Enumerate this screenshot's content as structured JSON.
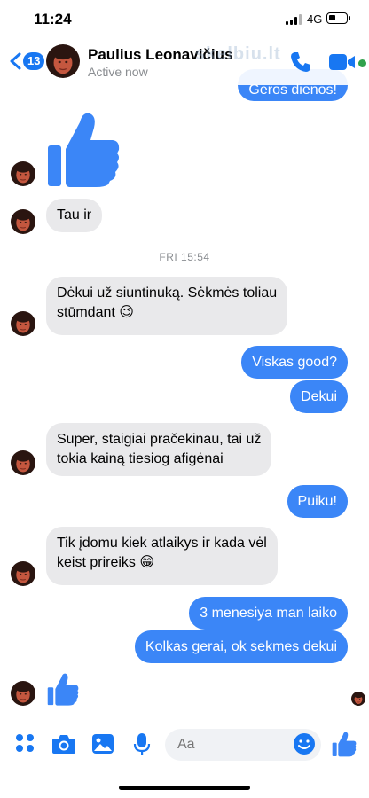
{
  "status_bar": {
    "time": "11:24",
    "network": "4G"
  },
  "header": {
    "back_badge": "13",
    "contact_name": "Paulius Leonavičius",
    "contact_status": "Active now",
    "watermark": "skelbiu.lt",
    "icons": [
      "chevron-left-icon",
      "phone-icon",
      "video-camera-icon"
    ]
  },
  "messages": {
    "partial_out": "Geros dienos!",
    "tau_ir": "Tau ir",
    "timestamp": "FRI 15:54",
    "dekui_line1": "Dėkui už siuntinuką. Sėkmės toliau",
    "dekui_line2": "stūmdant 😉",
    "viskas_good": "Viskas good?",
    "dekui": "Dekui",
    "super_line1": "Super, staigiai pračekinau, tai už",
    "super_line2": "tokia kainą tiesiog afigėnai",
    "puiku": "Puiku!",
    "tik_line1": "Tik įdomu kiek atlaikys ir kada vėl",
    "tik_line2": "keist prireiks 😁",
    "menesiya": "3 menesiya man laiko",
    "kolkas": "Kolkas gerai, ok sekmes dekui"
  },
  "composer": {
    "placeholder": "Aa",
    "icons": [
      "apps-icon",
      "camera-icon",
      "gallery-icon",
      "microphone-icon",
      "emoji-icon",
      "like-icon"
    ]
  },
  "colors": {
    "accent": "#1877f2",
    "outgoing_bubble": "#3b86f7",
    "incoming_bubble": "#e9e9eb",
    "online": "#31a24c"
  }
}
